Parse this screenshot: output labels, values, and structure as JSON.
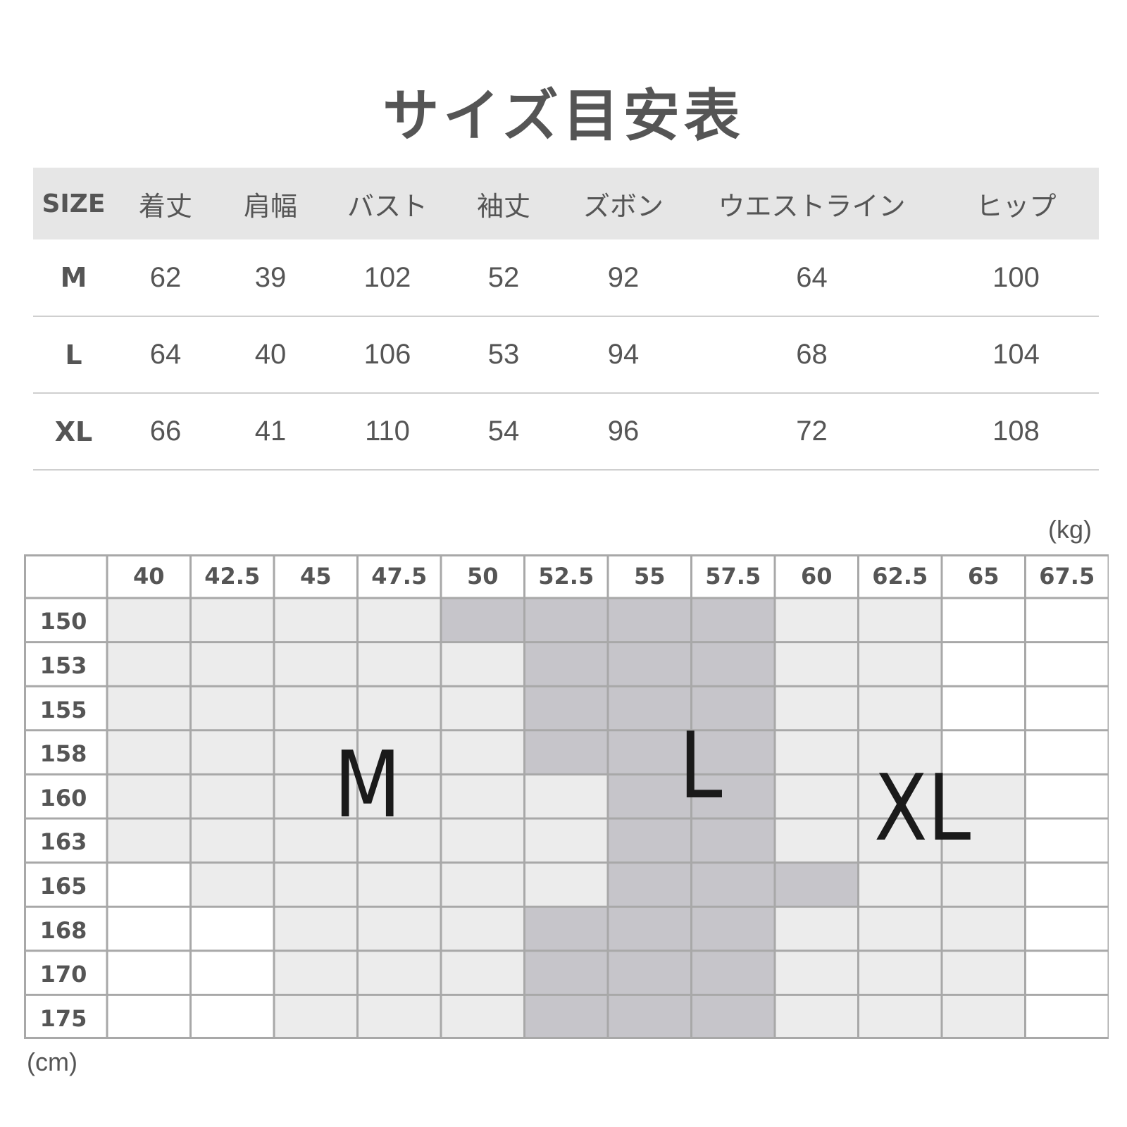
{
  "title": "サイズ目安表",
  "measurements": {
    "headers": [
      "SIZE",
      "着丈",
      "肩幅",
      "バスト",
      "袖丈",
      "ズボン",
      "ウエストライン",
      "ヒップ"
    ],
    "rows": [
      {
        "size": "M",
        "values": [
          "62",
          "39",
          "102",
          "52",
          "92",
          "64",
          "100"
        ]
      },
      {
        "size": "L",
        "values": [
          "64",
          "40",
          "106",
          "53",
          "94",
          "68",
          "104"
        ]
      },
      {
        "size": "XL",
        "values": [
          "66",
          "41",
          "110",
          "54",
          "96",
          "72",
          "108"
        ]
      }
    ]
  },
  "size_chart": {
    "unit_weight": "(kg)",
    "unit_height": "(cm)",
    "weights": [
      "40",
      "42.5",
      "45",
      "47.5",
      "50",
      "52.5",
      "55",
      "57.5",
      "60",
      "62.5",
      "65",
      "67.5"
    ],
    "heights": [
      "150",
      "153",
      "155",
      "158",
      "160",
      "163",
      "165",
      "168",
      "170",
      "175"
    ],
    "zone_labels": {
      "m": "M",
      "l": "L",
      "xl": "XL"
    },
    "cells": [
      [
        "light",
        "light",
        "light",
        "light",
        "dark",
        "dark",
        "dark",
        "dark",
        "light",
        "light",
        "white",
        "white"
      ],
      [
        "light",
        "light",
        "light",
        "light",
        "light",
        "dark",
        "dark",
        "dark",
        "light",
        "light",
        "white",
        "white"
      ],
      [
        "light",
        "light",
        "light",
        "light",
        "light",
        "dark",
        "dark",
        "dark",
        "light",
        "light",
        "white",
        "white"
      ],
      [
        "light",
        "light",
        "light",
        "light",
        "light",
        "dark",
        "dark",
        "dark",
        "light",
        "light",
        "white",
        "white"
      ],
      [
        "light",
        "light",
        "light",
        "light",
        "light",
        "light",
        "dark",
        "dark",
        "light",
        "light",
        "light",
        "white"
      ],
      [
        "light",
        "light",
        "light",
        "light",
        "light",
        "light",
        "dark",
        "dark",
        "light",
        "light",
        "light",
        "white"
      ],
      [
        "white",
        "light",
        "light",
        "light",
        "light",
        "light",
        "dark",
        "dark",
        "dark",
        "light",
        "light",
        "white"
      ],
      [
        "white",
        "white",
        "light",
        "light",
        "light",
        "dark",
        "dark",
        "dark",
        "light",
        "light",
        "light",
        "white"
      ],
      [
        "white",
        "white",
        "light",
        "light",
        "light",
        "dark",
        "dark",
        "dark",
        "light",
        "light",
        "light",
        "white"
      ],
      [
        "white",
        "white",
        "light",
        "light",
        "light",
        "dark",
        "dark",
        "dark",
        "light",
        "light",
        "light",
        "white"
      ]
    ],
    "colors": {
      "white": "#ffffff",
      "light": "#ececec",
      "dark": "#c6c5ca",
      "grid": "#a8a8a8",
      "label_col": "#ffffff"
    }
  }
}
